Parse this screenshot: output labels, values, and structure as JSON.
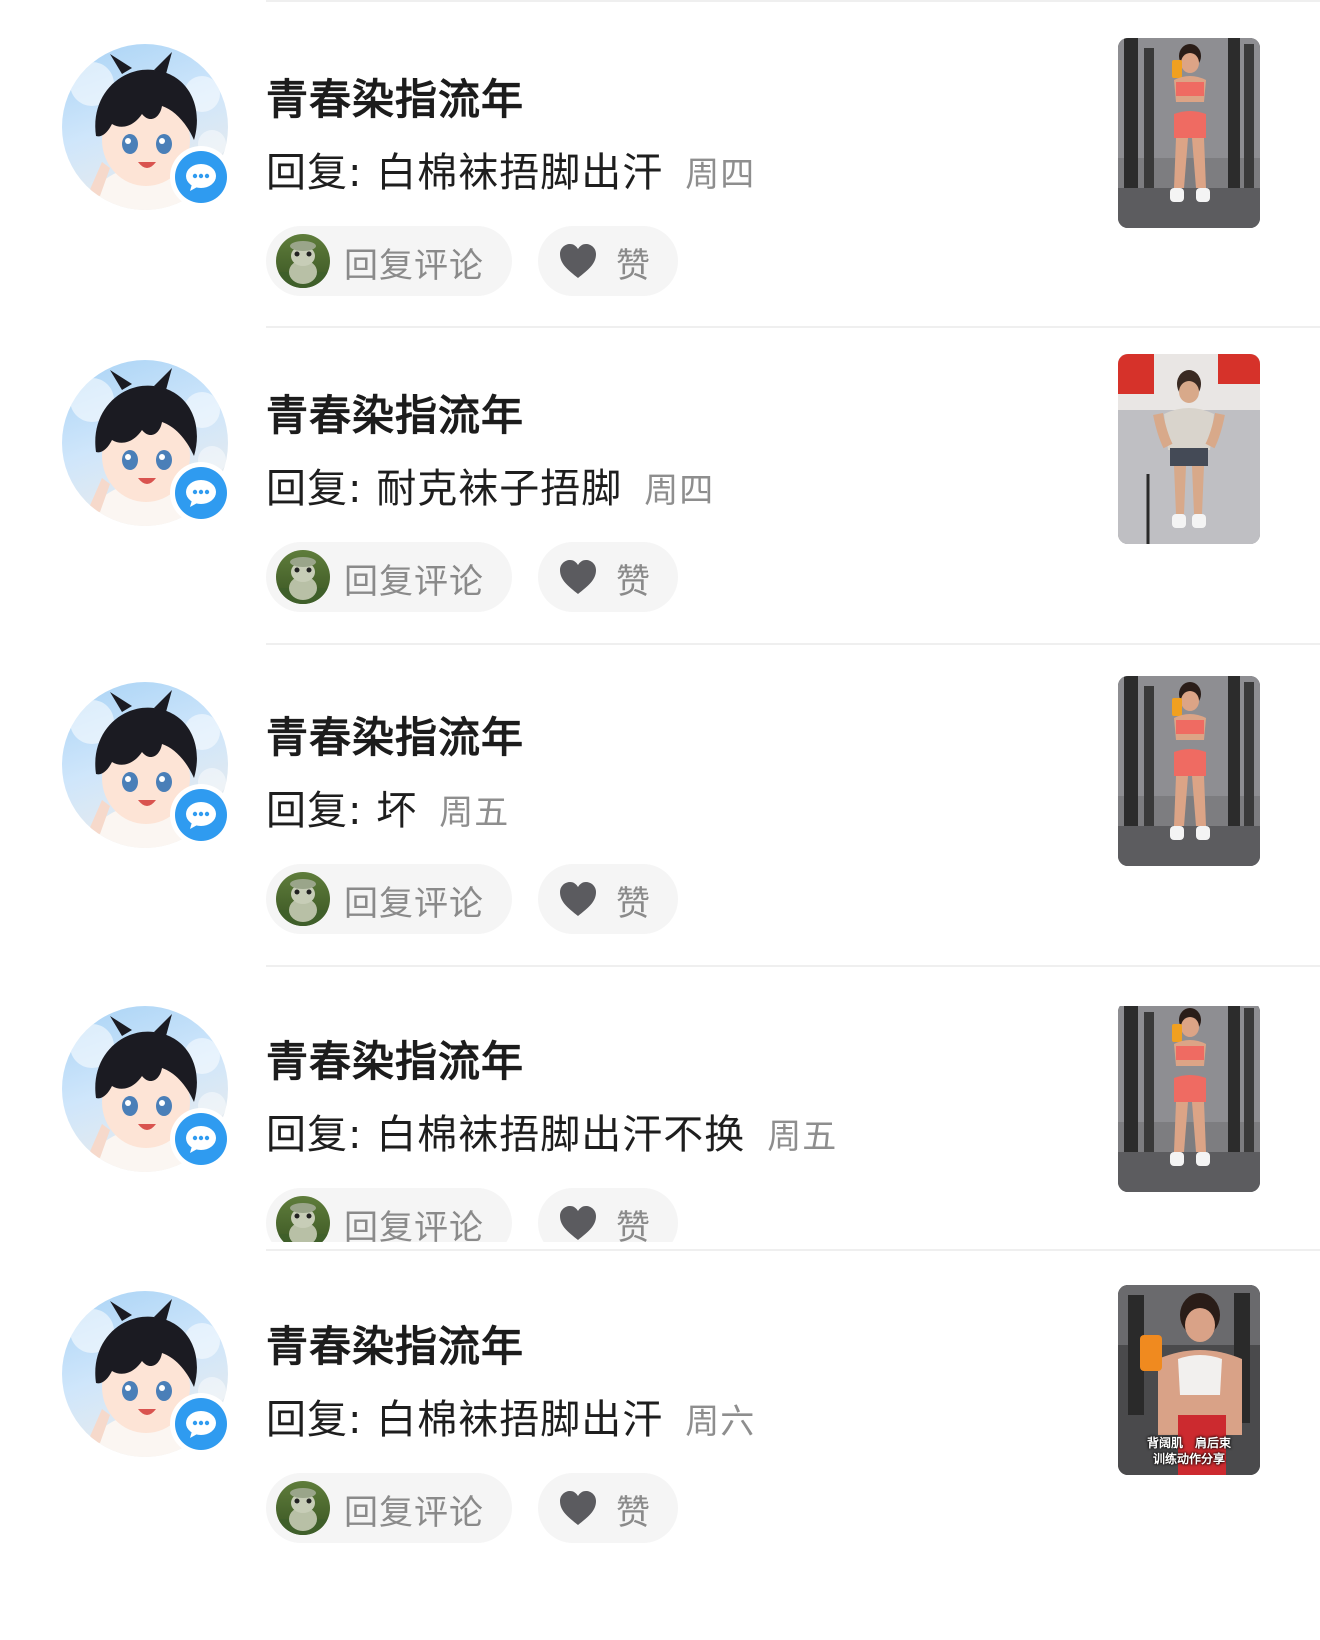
{
  "items": [
    {
      "username": "青春染指流年",
      "reply_text": "回复: 白棉袜捂脚出汗",
      "date": "周四",
      "reply_button": "回复评论",
      "like_label": "赞",
      "thumb_style": "orange",
      "thumb_caption": []
    },
    {
      "username": "青春染指流年",
      "reply_text": "回复: 耐克袜子捂脚",
      "date": "周四",
      "reply_button": "回复评论",
      "like_label": "赞",
      "thumb_style": "grey",
      "thumb_caption": []
    },
    {
      "username": "青春染指流年",
      "reply_text": "回复: 坏",
      "date": "周五",
      "reply_button": "回复评论",
      "like_label": "赞",
      "thumb_style": "orange",
      "thumb_caption": []
    },
    {
      "username": "青春染指流年",
      "reply_text": "回复: 白棉袜捂脚出汗不换",
      "date": "周五",
      "reply_button": "回复评论",
      "like_label": "赞",
      "thumb_style": "orange",
      "thumb_caption": []
    },
    {
      "username": "青春染指流年",
      "reply_text": "回复: 白棉袜捂脚出汗",
      "date": "周六",
      "reply_button": "回复评论",
      "like_label": "赞",
      "thumb_style": "closeup",
      "thumb_caption": [
        "背阔肌　肩后束",
        "训练动作分享"
      ]
    }
  ],
  "icons": {
    "badge": "message-bubble-icon",
    "like": "heart-icon"
  },
  "colors": {
    "badge_blue": "#2f9bf0",
    "muted_text": "#8a8a8a",
    "date_text": "#8e8e8e",
    "pill_bg": "#f5f5f5"
  }
}
